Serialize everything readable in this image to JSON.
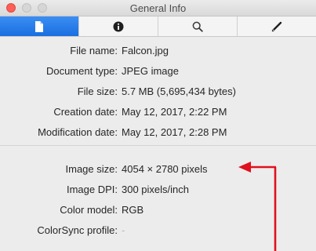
{
  "window": {
    "title": "General Info"
  },
  "toolbar": {
    "tabs": [
      {
        "icon": "document-icon",
        "active": true
      },
      {
        "icon": "info-icon",
        "active": false
      },
      {
        "icon": "magnifier-icon",
        "active": false
      },
      {
        "icon": "pencil-icon",
        "active": false
      }
    ]
  },
  "general": [
    {
      "label": "File name:",
      "value": "Falcon.jpg"
    },
    {
      "label": "Document type:",
      "value": "JPEG image"
    },
    {
      "label": "File size:",
      "value": "5.7 MB (5,695,434 bytes)"
    },
    {
      "label": "Creation date:",
      "value": "May 12, 2017, 2:22 PM"
    },
    {
      "label": "Modification date:",
      "value": "May 12, 2017, 2:28 PM"
    }
  ],
  "image": [
    {
      "label": "Image size:",
      "value": "4054 × 2780 pixels"
    },
    {
      "label": "Image DPI:",
      "value": "300 pixels/inch"
    },
    {
      "label": "Color model:",
      "value": "RGB"
    },
    {
      "label": "ColorSync profile:",
      "value": "-"
    }
  ],
  "colors": {
    "active_tab": "#1a6fe0",
    "annotation": "#e0101e"
  }
}
